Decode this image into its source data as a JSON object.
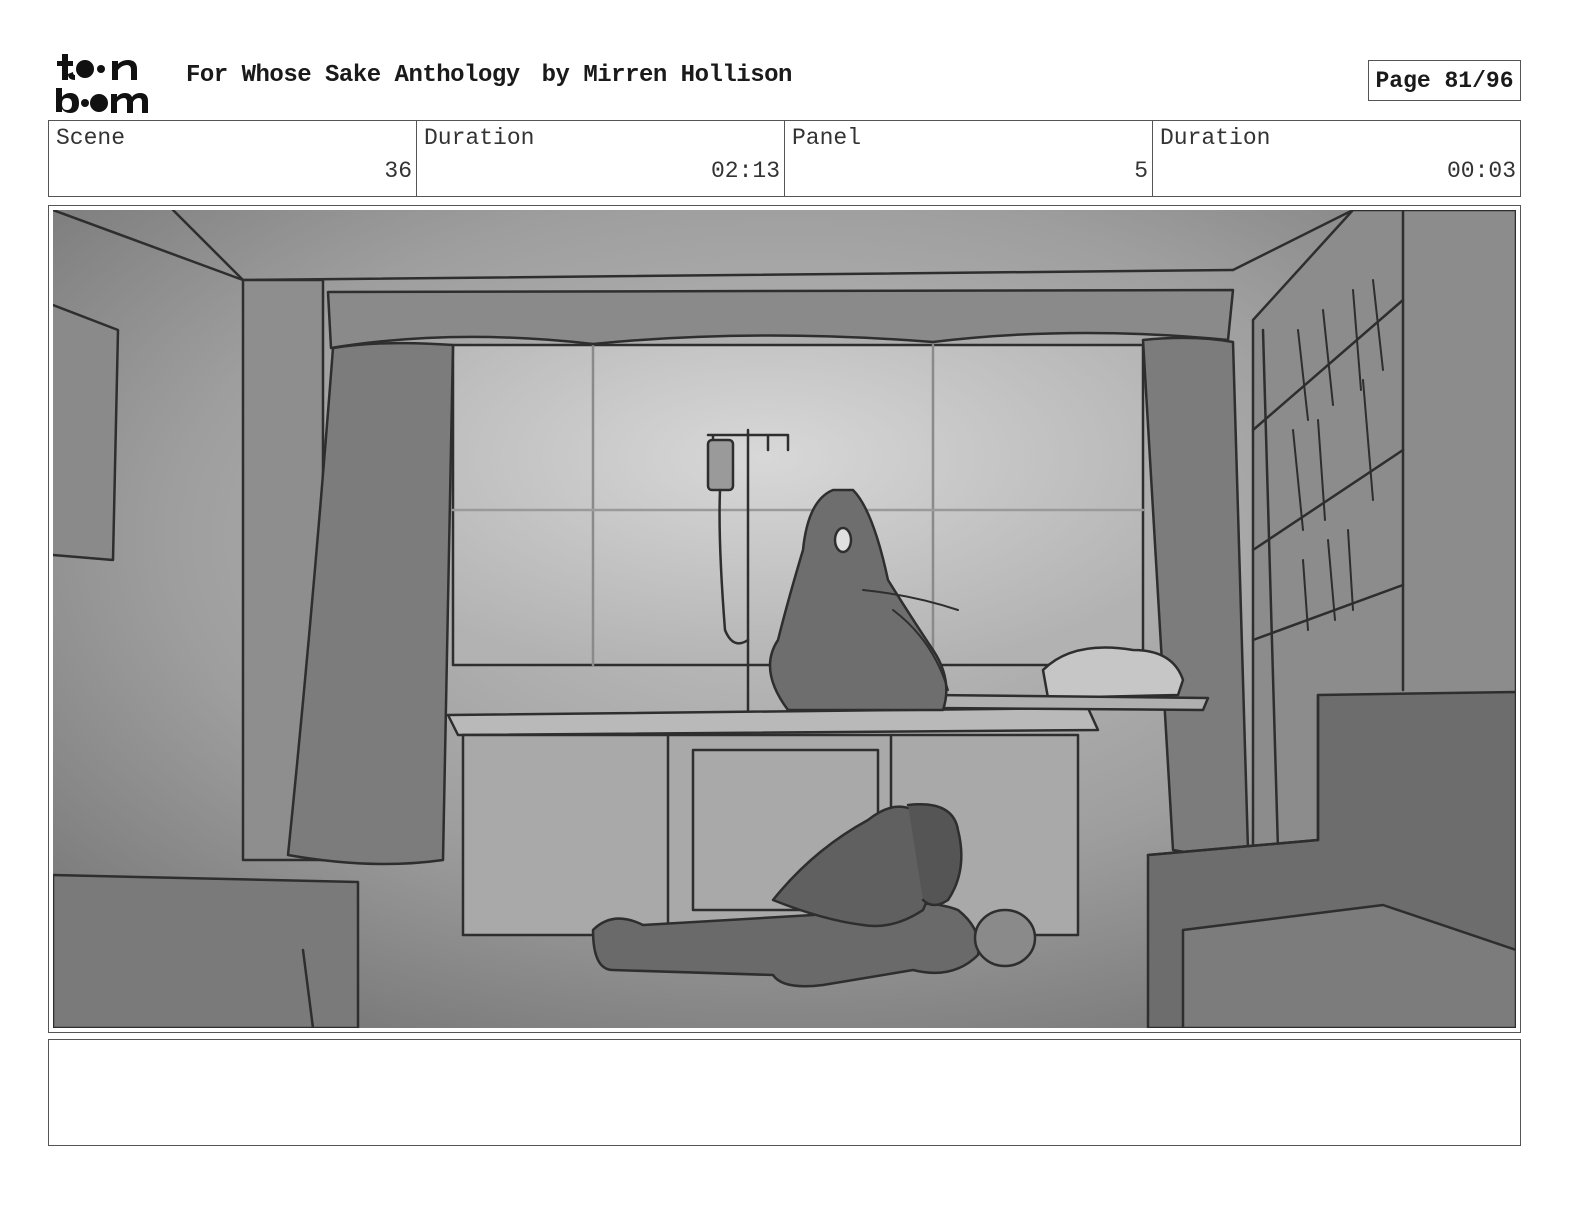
{
  "header": {
    "logo_line1": "toon",
    "logo_line2": "boom",
    "title": "For Whose Sake Anthology",
    "author": "by Mirren Hollison",
    "page_label": "Page 81/96"
  },
  "info": [
    {
      "label": "Scene",
      "value": "36"
    },
    {
      "label": "Duration",
      "value": "02:13"
    },
    {
      "label": "Panel",
      "value": "5"
    },
    {
      "label": "Duration",
      "value": "00:03"
    }
  ],
  "panel": {
    "description": "",
    "tones": {
      "light": "#bdbdbd",
      "mid": "#8f8f8f",
      "dark": "#6a6a6a",
      "line": "#2e2e2e"
    }
  },
  "notes": ""
}
